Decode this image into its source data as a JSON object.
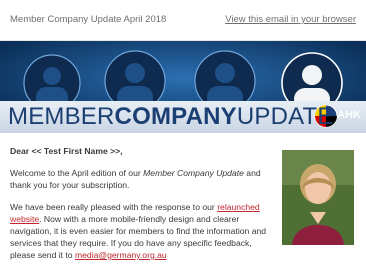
{
  "header": {
    "title": "Member Company Update April 2018",
    "view_link": "View this email in your browser"
  },
  "banner": {
    "title_part1": "MEMBER",
    "title_part2": "COMPANY",
    "title_part3": "UPDATE",
    "logo_text": "AHK"
  },
  "email": {
    "greeting": "Dear << Test First Name >>,",
    "p1_a": "Welcome to the April edition of our ",
    "p1_em": "Member Company Update",
    "p1_b": " and thank you for your subscription.",
    "p2_a": "We have been really pleased with the response to our ",
    "p2_link": "relaunched website",
    "p2_b": ". Now with a more mobile-friendly design and clearer navigation, it is even easier for members to find the information and services that they require. If you do have any specific feedback, please send it to ",
    "p2_email": "media@germany.org.au"
  },
  "colors": {
    "banner_blue": "#0f3a6a",
    "link_red": "#c0282f"
  }
}
